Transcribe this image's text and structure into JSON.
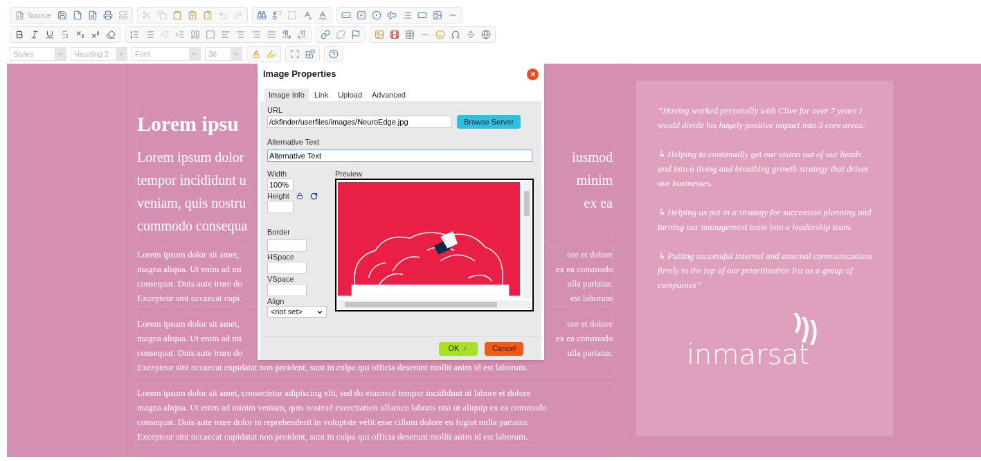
{
  "toolbar": {
    "source_label": "Source",
    "styles_combo": "Styles",
    "format_combo": "Heading 2",
    "font_combo": "Font",
    "size_combo": "36"
  },
  "content": {
    "heading": "Lorem ipsu",
    "lead_lines": [
      {
        "left": "Lorem ipsum dolor",
        "right": "iusmod"
      },
      {
        "left": "tempor incididunt u",
        "right": "minim"
      },
      {
        "left": "veniam, quis nostru",
        "right": "ex ea"
      },
      {
        "left": "commodo consequa"
      }
    ],
    "paragraphs": [
      [
        {
          "left": "Lorem ipsum dolor sit amet,",
          "right": "ore et dolore"
        },
        {
          "left": "magna aliqua. Ut enim ad mi",
          "right": "ex ea commodo"
        },
        {
          "left": "consequat. Duis aute irure do",
          "right": "ulla pariatur."
        },
        {
          "left": "Excepteur sint occaecat cupi",
          "right": "est laborum"
        }
      ],
      [
        {
          "left": "Lorem ipsum dolor sit amet,",
          "right": "ore et dolore"
        },
        {
          "left": "magna aliqua. Ut enim ad mi",
          "right": "ex ea commodo"
        },
        {
          "left": "consequat. Duis aute irure do",
          "right": "ulla pariatur."
        },
        {
          "left": "Excepteur sint occaecat cupidatat non proident, sunt in culpa qui officia deserunt mollit anim id est laborum."
        }
      ],
      [
        {
          "left": "Lorem ipsum dolor sit amet, consectetur adipiscing elit, sed do eiusmod tempor incididunt ut labore et dolore"
        },
        {
          "left": "magna aliqua. Ut enim ad minim veniam, quis nostrud exercitation ullamco laboris nisi ut aliquip ex ea commodo"
        },
        {
          "left": "consequat. Duis aute irure dolor in reprehenderit in voluptate velit esse cillum dolore eu fugiat nulla pariatur."
        },
        {
          "left": "Excepteur sint occaecat cupidatat non proident, sunt in culpa qui officia deserunt mollit anim id est laborum."
        }
      ]
    ]
  },
  "testimonial": {
    "paragraphs": [
      "“Having worked personally with Clive for over 7 years I would divide his hugely positive impact into 3 core areas:",
      "↳ Helping to continually get our vision out of our heads and into a living and breathing growth strategy that drives our businesses.",
      "↳ Helping us put in a strategy for succession planning and turning our management team into a leadership team.",
      "↳ Putting successful internal and external communications firmly to the top of our prioritisation list as a group of companies”"
    ],
    "logo_text": "inmarsat"
  },
  "dialog": {
    "title": "Image Properties",
    "tabs": [
      {
        "label": "Image Info",
        "selected": true
      },
      {
        "label": "Link",
        "selected": false
      },
      {
        "label": "Upload",
        "selected": false
      },
      {
        "label": "Advanced",
        "selected": false
      }
    ],
    "url": {
      "label": "URL",
      "value": "/ckfinder/userfiles/images/NeuroEdge.jpg"
    },
    "browse_button": "Browse Server",
    "alt": {
      "label": "Alternative Text",
      "value": "Alternative Text"
    },
    "width": {
      "label": "Width",
      "value": "100%"
    },
    "height": {
      "label": "Height"
    },
    "border": {
      "label": "Border"
    },
    "hspace": {
      "label": "HSpace"
    },
    "vspace": {
      "label": "VSpace"
    },
    "align": {
      "label": "Align",
      "value": "<not set>"
    },
    "preview_label": "Preview",
    "ok_button": "OK",
    "cancel_button": "Cancel"
  }
}
